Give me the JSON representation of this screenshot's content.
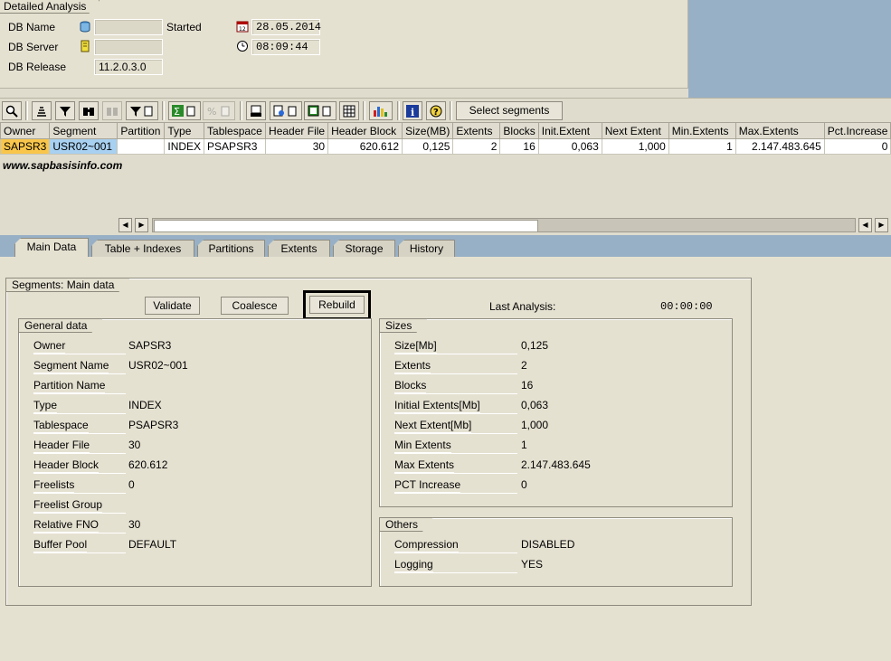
{
  "header": {
    "title": "Detailed Analysis",
    "db_name_label": "DB Name",
    "db_server_label": "DB Server",
    "db_release_label": "DB Release",
    "db_release_value": "11.2.0.3.0",
    "started_label": "Started",
    "date_value": "28.05.2014",
    "time_value": "08:09:44"
  },
  "toolbar": {
    "icons": [
      "details-icon",
      "print-icon",
      "filter-icon",
      "find-icon",
      "find-next-icon",
      "filter-set-icon",
      "sum-icon",
      "subtotal-icon",
      "print-preview-icon",
      "export-icon",
      "spreadsheet-icon",
      "layout-icon",
      "chart-icon",
      "info-icon",
      "help-icon"
    ],
    "select_segments_label": "Select segments"
  },
  "grid": {
    "columns": [
      "Owner",
      "Segment",
      "Partition",
      "Type",
      "Tablespace",
      "Header File",
      "Header Block",
      "Size(MB)",
      "Extents",
      "Blocks",
      "Init.Extent",
      "Next Extent",
      "Min.Extents",
      "Max.Extents",
      "Pct.Increase"
    ],
    "row": [
      "SAPSR3",
      "USR02~001",
      "",
      "INDEX",
      "PSAPSR3",
      "30",
      "620.612",
      "0,125",
      "2",
      "16",
      "0,063",
      "1,000",
      "1",
      "2.147.483.645",
      "0"
    ]
  },
  "watermark": "www.sapbasisinfo.com",
  "tabs": [
    "Main Data",
    "Table + Indexes",
    "Partitions",
    "Extents",
    "Storage",
    "History"
  ],
  "main": {
    "frame_title": "Segments: Main data",
    "validate_label": "Validate",
    "coalesce_label": "Coalesce",
    "rebuild_label": "Rebuild",
    "last_analysis_label": "Last Analysis:",
    "last_analysis_value": "00:00:00",
    "general": {
      "title": "General data",
      "rows": [
        {
          "label": "Owner",
          "value": "SAPSR3"
        },
        {
          "label": "Segment Name",
          "value": "USR02~001"
        },
        {
          "label": "Partition Name",
          "value": ""
        },
        {
          "label": "Type",
          "value": "INDEX"
        },
        {
          "label": "Tablespace",
          "value": "PSAPSR3"
        },
        {
          "label": "Header File",
          "value": "30"
        },
        {
          "label": "Header Block",
          "value": "620.612"
        },
        {
          "label": "Freelists",
          "value": "0"
        },
        {
          "label": "Freelist Group",
          "value": ""
        },
        {
          "label": "Relative FNO",
          "value": "30"
        },
        {
          "label": "Buffer Pool",
          "value": "DEFAULT"
        }
      ]
    },
    "sizes": {
      "title": "Sizes",
      "rows": [
        {
          "label": "Size[Mb]",
          "value": "0,125"
        },
        {
          "label": "Extents",
          "value": "2"
        },
        {
          "label": "Blocks",
          "value": "16"
        },
        {
          "label": "Initial Extents[Mb]",
          "value": "0,063"
        },
        {
          "label": "Next Extent[Mb]",
          "value": "1,000"
        },
        {
          "label": "Min Extents",
          "value": "1"
        },
        {
          "label": "Max Extents",
          "value": "2.147.483.645"
        },
        {
          "label": "PCT Increase",
          "value": "0"
        }
      ]
    },
    "others": {
      "title": "Others",
      "rows": [
        {
          "label": "Compression",
          "value": "DISABLED"
        },
        {
          "label": "Logging",
          "value": "YES"
        }
      ]
    }
  }
}
